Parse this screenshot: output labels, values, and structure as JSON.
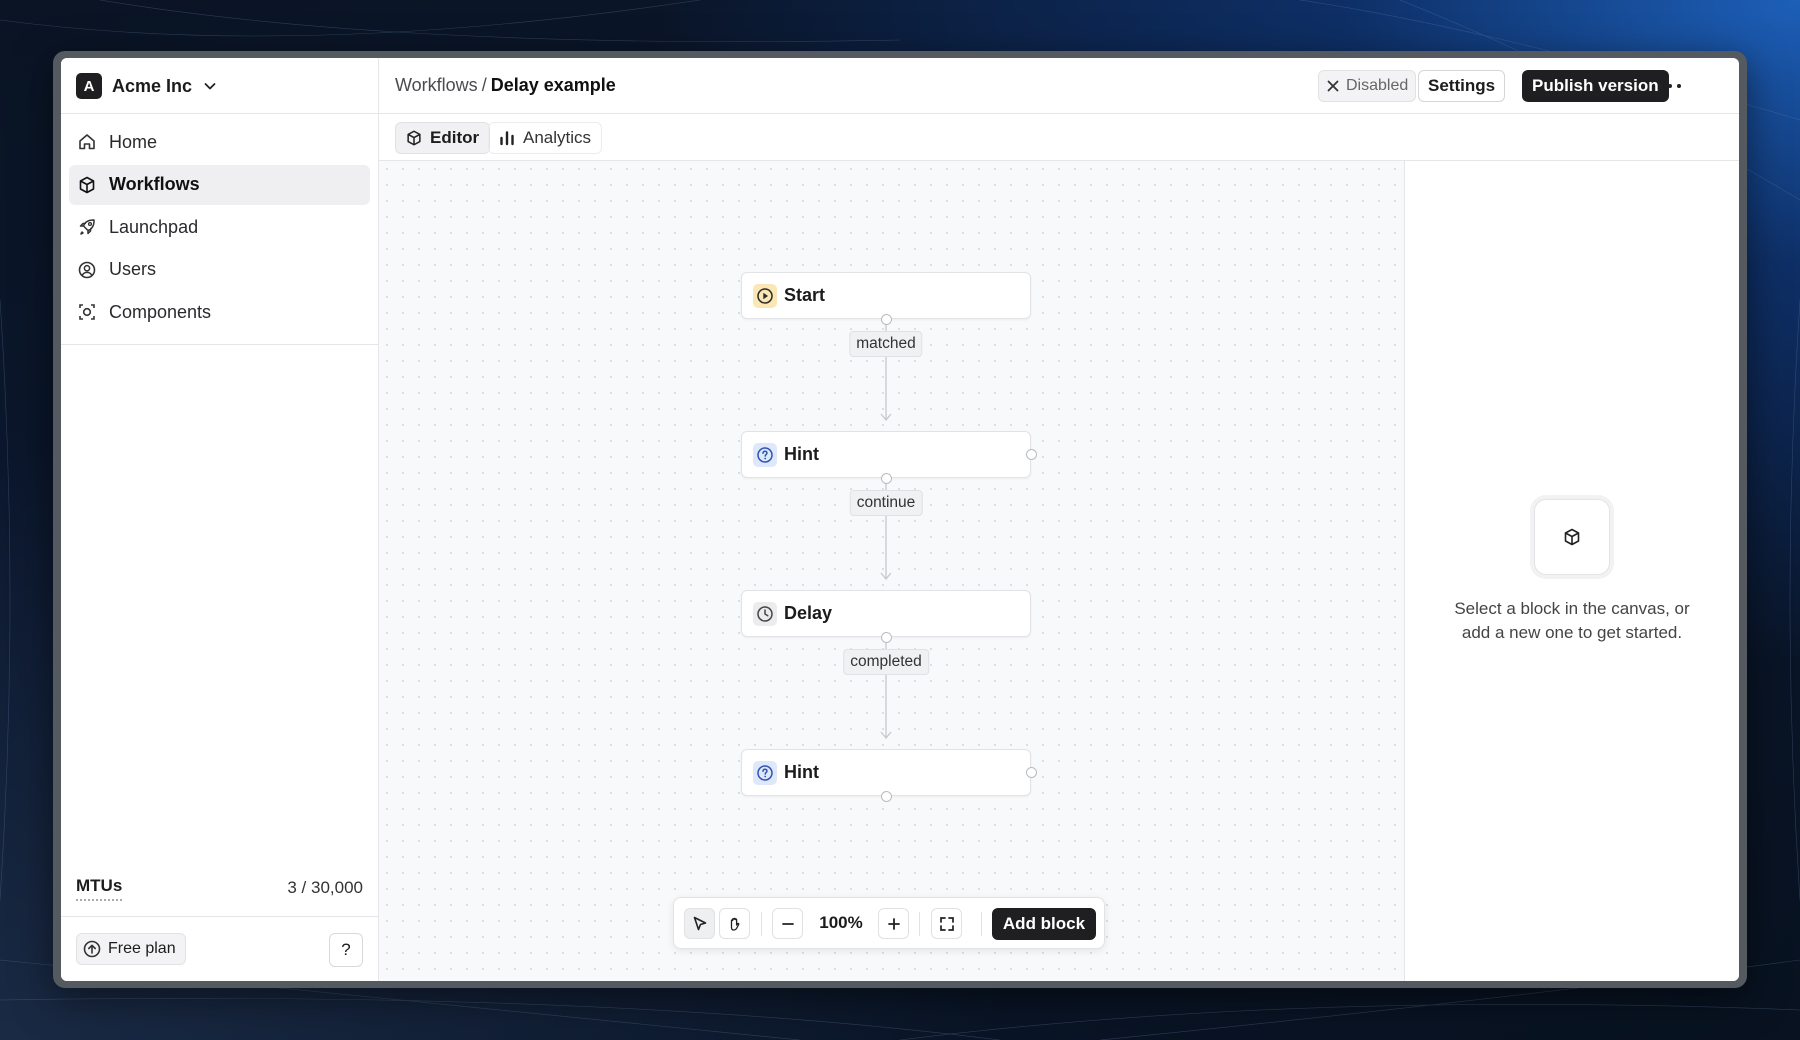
{
  "org": {
    "badge": "A",
    "name": "Acme Inc"
  },
  "sidebar": {
    "items": [
      {
        "label": "Home",
        "icon": "home-icon",
        "active": false
      },
      {
        "label": "Workflows",
        "icon": "cube-icon",
        "active": true
      },
      {
        "label": "Launchpad",
        "icon": "rocket-icon",
        "active": false
      },
      {
        "label": "Users",
        "icon": "user-circle-icon",
        "active": false
      },
      {
        "label": "Components",
        "icon": "component-icon",
        "active": false
      }
    ],
    "usage": {
      "label": "MTUs",
      "value": "3 / 30,000"
    },
    "plan_label": "Free plan",
    "help_label": "?"
  },
  "header": {
    "breadcrumb_parent": "Workflows",
    "breadcrumb_sep": "/",
    "breadcrumb_current": "Delay example",
    "status_label": "Disabled",
    "settings_label": "Settings",
    "publish_label": "Publish version"
  },
  "tabs": [
    {
      "label": "Editor",
      "active": true
    },
    {
      "label": "Analytics",
      "active": false
    }
  ],
  "workflow": {
    "nodes": [
      {
        "label": "Start",
        "type": "start"
      },
      {
        "label": "Hint",
        "type": "hint"
      },
      {
        "label": "Delay",
        "type": "delay"
      },
      {
        "label": "Hint",
        "type": "hint"
      }
    ],
    "edges": [
      "matched",
      "continue",
      "completed"
    ]
  },
  "toolbar": {
    "zoom": "100%",
    "add_block_label": "Add block"
  },
  "panel": {
    "empty_line1": "Select a block in the canvas, or",
    "empty_line2": "add a new one to get started."
  },
  "colors": {
    "start_icon_bg": "#fbe7b5",
    "hint_icon_bg": "#dfe8fb",
    "delay_icon_bg": "#ececee",
    "primary_button": "#1f1f22"
  }
}
